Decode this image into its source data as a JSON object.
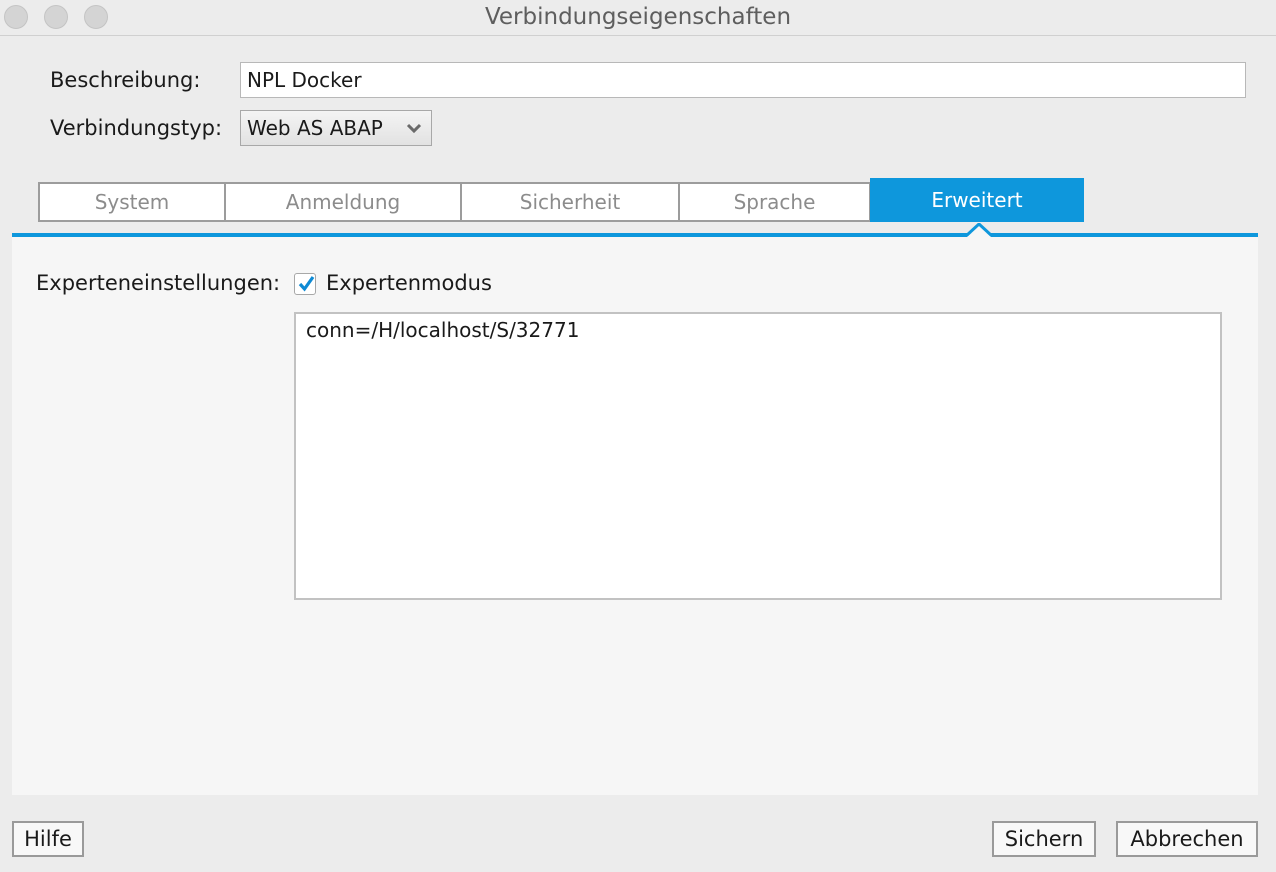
{
  "window": {
    "title": "Verbindungseigenschaften"
  },
  "form": {
    "description_label": "Beschreibung:",
    "description_value": "NPL Docker",
    "type_label": "Verbindungstyp:",
    "type_value": "Web AS ABAP"
  },
  "tabs": [
    {
      "label": "System",
      "active": false
    },
    {
      "label": "Anmeldung",
      "active": false
    },
    {
      "label": "Sicherheit",
      "active": false
    },
    {
      "label": "Sprache",
      "active": false
    },
    {
      "label": "Erweitert",
      "active": true
    }
  ],
  "advanced": {
    "expert_label": "Experteneinstellungen:",
    "expert_checkbox_label": "Expertenmodus",
    "expert_checked": true,
    "expert_text": "conn=/H/localhost/S/32771"
  },
  "buttons": {
    "help": "Hilfe",
    "save": "Sichern",
    "cancel": "Abbrechen"
  },
  "colors": {
    "accent": "#0e97dc"
  }
}
